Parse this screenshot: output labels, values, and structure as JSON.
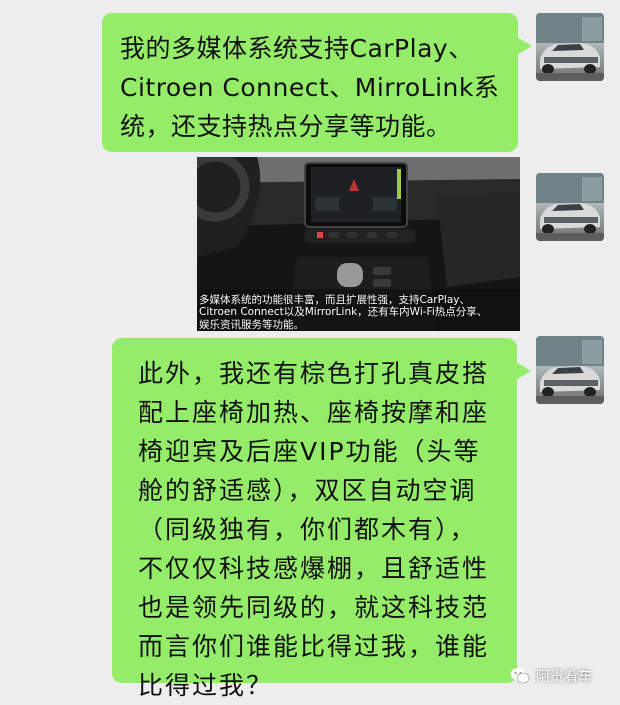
{
  "messages": [
    {
      "lines": [
        "我的多媒体系统支持CarPlay、",
        "Citroen Connect、MirroLink系",
        "统，还支持热点分享等功能。"
      ]
    },
    {
      "caption_lines": [
        "多媒体系统的功能很丰富，而且扩展性强，支持CarPlay、",
        "Citroen Connect以及MirrorLink，还有车内Wi-Fi热点分享、",
        "娱乐资讯服务等功能。"
      ]
    },
    {
      "lines": [
        "此外，我还有棕色打孔真皮搭",
        "配上座椅加热、座椅按摩和座",
        "椅迎宾及后座VIP功能（头等",
        "舱的舒适感），双区自动空调",
        "（同级独有，你们都木有），",
        "不仅仅科技感爆棚，且舒适性",
        "也是领先同级的，就这科技范",
        "而言你们谁能比得过我，谁能",
        "比得过我？"
      ]
    }
  ],
  "watermark": {
    "text": "阿贵看车",
    "icon": "wechat-logo-icon"
  },
  "colors": {
    "background": "#ededed",
    "bubble": "#95ec69",
    "text": "#111111"
  }
}
